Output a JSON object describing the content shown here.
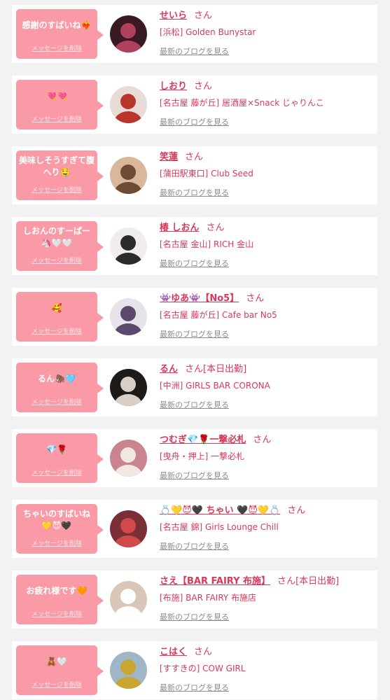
{
  "delete_label": "メッセージを削除",
  "blog_label": "最新のブログを見る",
  "suffix": "さん",
  "colors": {
    "accent": "#d9385a",
    "bubble": "#f99aa6",
    "page_bg": "#f2f2f2"
  },
  "items": [
    {
      "message": "感謝のすばいね❤️‍🔥",
      "name": "せいら",
      "status": "",
      "shop": "[浜松] Golden Bunystar",
      "avatar_colors": [
        "#3a1a22",
        "#b0415c"
      ]
    },
    {
      "message": "💘💘",
      "name": "しおり",
      "status": "",
      "shop": "[名古屋 藤が丘] 居酒屋×Snack じゃりんこ",
      "avatar_colors": [
        "#e9dcd6",
        "#b9362c"
      ]
    },
    {
      "message": "美味しそうすぎて腹へり🤤",
      "name": "笑蓮",
      "status": "",
      "shop": "[蒲田駅東口] Club Seed",
      "avatar_colors": [
        "#d8b79a",
        "#6e4a36"
      ]
    },
    {
      "message": "しおんのすーぱー🦄🤍🤍",
      "name": "椿 しおん",
      "status": "",
      "shop": "[名古屋 金山] RICH 金山",
      "avatar_colors": [
        "#f0ecec",
        "#2b2b2b"
      ]
    },
    {
      "message": "🥰",
      "name": "👾ゆあ👾【No5】",
      "status": "",
      "shop": "[名古屋 藤が丘] Cafe bar No5",
      "avatar_colors": [
        "#e6e3ea",
        "#5b4a6e"
      ]
    },
    {
      "message": "るん🦣🩵",
      "name": "るん",
      "status": "[本日出勤]",
      "shop": "[中洲] GIRLS BAR CORONA",
      "avatar_colors": [
        "#1e1a1a",
        "#d9cfc6"
      ]
    },
    {
      "message": "💎🌹",
      "name": "つむぎ💎🌹一撃必札",
      "status": "",
      "shop": "[曳舟・押上] 一撃必札",
      "avatar_colors": [
        "#c9858f",
        "#f3e7e4"
      ]
    },
    {
      "message": "ちゃいのすばいね💛😈🖤",
      "name": "💍💛😈🖤 ちゃい 🖤😈💛💍",
      "status": "",
      "shop": "[名古屋 錦] Girls Lounge Chill",
      "avatar_colors": [
        "#7a2f36",
        "#d14a4a"
      ]
    },
    {
      "message": "お疲れ様です🧡",
      "name": "さえ【BAR FAIRY 布施】",
      "status": "[本日出勤]",
      "shop": "[布施] BAR FAIRY 布施店",
      "avatar_colors": [
        "#d9c6b8",
        "#ffffff"
      ]
    },
    {
      "message": "🧸🤍",
      "name": "こはく",
      "status": "",
      "shop": "[すすきの] COW GIRL",
      "avatar_colors": [
        "#9fb6c8",
        "#c9a62f"
      ]
    }
  ]
}
